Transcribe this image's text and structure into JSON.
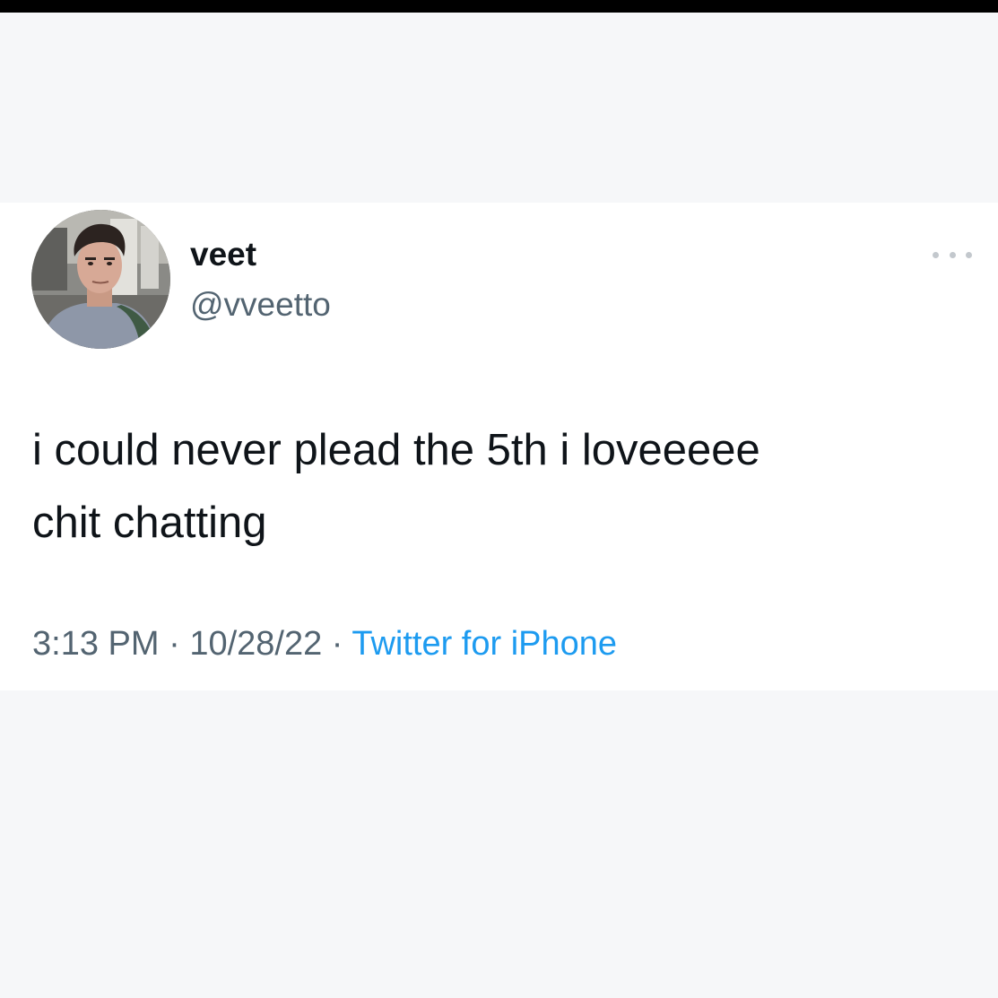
{
  "tweet": {
    "display_name": "veet",
    "handle": "@vveetto",
    "text": "i could never plead the 5th i loveeeee\nchit chatting",
    "time": "3:13 PM",
    "separator": " · ",
    "date": "10/28/22",
    "source": "Twitter for iPhone"
  },
  "icons": {
    "more": "more-horizontal-icon",
    "avatar": "profile-photo"
  },
  "colors": {
    "text_primary": "#0f1419",
    "text_secondary": "#536471",
    "link": "#1d9bf0",
    "card_background": "#ffffff",
    "page_background": "#f6f7f9",
    "top_bar": "#000000"
  }
}
